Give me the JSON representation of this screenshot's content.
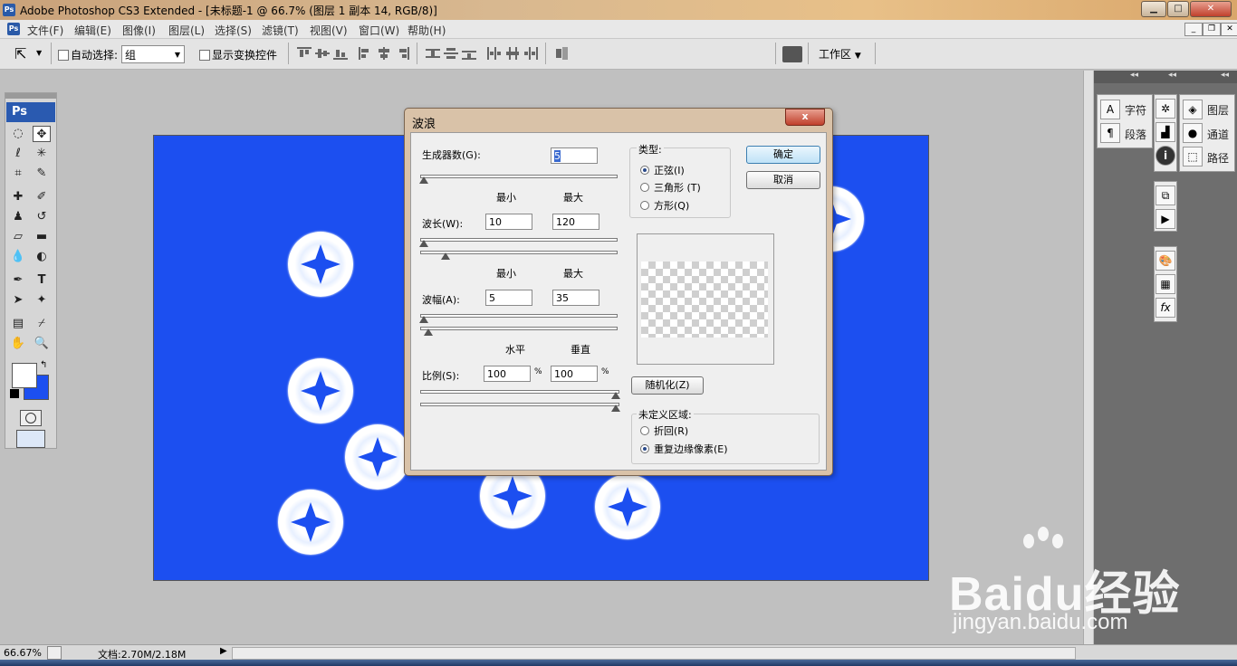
{
  "window": {
    "title": "Adobe Photoshop CS3 Extended - [未标题-1 @ 66.7% (图层 1 副本 14, RGB/8)]",
    "app_icon": "Ps"
  },
  "menubar": {
    "items": [
      "文件(F)",
      "编辑(E)",
      "图像(I)",
      "图层(L)",
      "选择(S)",
      "滤镜(T)",
      "视图(V)",
      "窗口(W)",
      "帮助(H)"
    ]
  },
  "options_bar": {
    "auto_select_label": "自动选择:",
    "auto_select_value": "组",
    "show_transform_label": "显示变换控件",
    "workspace_label": "工作区"
  },
  "toolbox": {
    "logo": "Ps"
  },
  "panels": {
    "group1": [
      "字符",
      "段落"
    ],
    "group2": [
      "图层",
      "通道",
      "路径"
    ]
  },
  "status": {
    "zoom": "66.67%",
    "doc_size": "文档:2.70M/2.18M"
  },
  "dialog": {
    "title": "波浪",
    "close_glyph": "x",
    "generators_label": "生成器数(G):",
    "generators_value": "5",
    "min_label": "最小",
    "max_label": "最大",
    "wavelength_label": "波长(W):",
    "wavelength_min": "10",
    "wavelength_max": "120",
    "amplitude_label": "波幅(A):",
    "amplitude_min": "5",
    "amplitude_max": "35",
    "horizontal_label": "水平",
    "vertical_label": "垂直",
    "scale_label": "比例(S):",
    "scale_h": "100",
    "scale_v": "100",
    "percent": "%",
    "type_label": "类型:",
    "type_options": [
      "正弦(I)",
      "三角形 (T)",
      "方形(Q)"
    ],
    "type_selected": 0,
    "ok_label": "确定",
    "cancel_label": "取消",
    "randomize_label": "随机化(Z)",
    "undefined_label": "未定义区域:",
    "undefined_options": [
      "折回(R)",
      "重复边缘像素(E)"
    ],
    "undefined_selected": 1
  },
  "watermark": {
    "brand": "Baidu经验",
    "url": "jingyan.baidu.com"
  },
  "colors": {
    "canvas_blue": "#1c4ff0",
    "foreground": "#ffffff",
    "background": "#1c4ff0"
  }
}
